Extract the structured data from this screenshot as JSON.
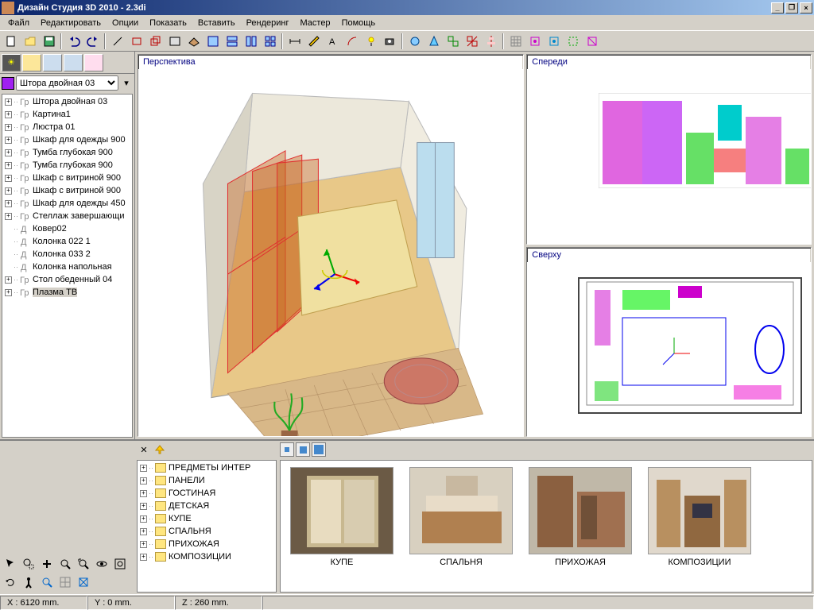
{
  "window": {
    "title": "Дизайн Студия 3D 2010 - 2.3di"
  },
  "menu": [
    "Файл",
    "Редактировать",
    "Опции",
    "Показать",
    "Вставить",
    "Рендеринг",
    "Мастер",
    "Помощь"
  ],
  "selected_object": "Штора двойная 03",
  "scene_tree": [
    {
      "exp": true,
      "kind": "grp",
      "label": "Штора двойная 03"
    },
    {
      "exp": true,
      "kind": "grp",
      "label": "Картина1"
    },
    {
      "exp": true,
      "kind": "grp",
      "label": "Люстра 01"
    },
    {
      "exp": true,
      "kind": "grp",
      "label": "Шкаф для одежды 900"
    },
    {
      "exp": true,
      "kind": "grp",
      "label": "Тумба глубокая 900"
    },
    {
      "exp": true,
      "kind": "grp",
      "label": "Тумба глубокая 900"
    },
    {
      "exp": true,
      "kind": "grp",
      "label": "Шкаф с витриной 900"
    },
    {
      "exp": true,
      "kind": "grp",
      "label": "Шкаф с витриной 900"
    },
    {
      "exp": true,
      "kind": "grp",
      "label": "Шкаф для одежды 450"
    },
    {
      "exp": true,
      "kind": "grp",
      "label": "Стеллаж завершающи"
    },
    {
      "exp": false,
      "kind": "det",
      "label": "Ковер02"
    },
    {
      "exp": false,
      "kind": "det",
      "label": "Колонка 022 1"
    },
    {
      "exp": false,
      "kind": "det",
      "label": "Колонка 033 2"
    },
    {
      "exp": false,
      "kind": "det",
      "label": "Колонка напольная"
    },
    {
      "exp": true,
      "kind": "grp",
      "label": "Стол обеденный 04"
    },
    {
      "exp": true,
      "kind": "grp",
      "label": "Плазма ТВ",
      "sel": true
    }
  ],
  "viewports": {
    "perspective": "Перспектива",
    "front": "Спереди",
    "top": "Сверху"
  },
  "categories": [
    "ПРЕДМЕТЫ ИНТЕР",
    "ПАНЕЛИ",
    "ГОСТИНАЯ",
    "ДЕТСКАЯ",
    "КУПЕ",
    "СПАЛЬНЯ",
    "ПРИХОЖАЯ",
    "КОМПОЗИЦИИ"
  ],
  "thumbnails": [
    {
      "label": "КУПЕ"
    },
    {
      "label": "СПАЛЬНЯ"
    },
    {
      "label": "ПРИХОЖАЯ"
    },
    {
      "label": "КОМПОЗИЦИИ"
    }
  ],
  "status": {
    "x": "X : 6120 mm.",
    "y": "Y : 0 mm.",
    "z": "Z : 260 mm."
  }
}
